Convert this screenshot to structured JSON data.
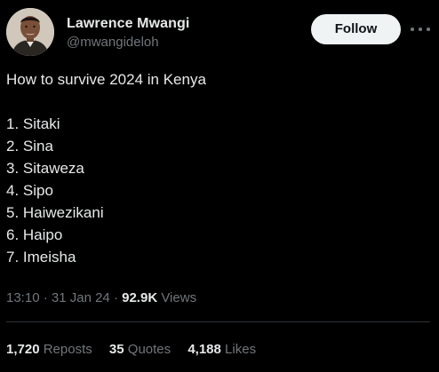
{
  "author": {
    "display_name": "Lawrence Mwangi",
    "handle": "@mwangideloh"
  },
  "actions": {
    "follow_label": "Follow",
    "more_icon": "more-horizontal-icon"
  },
  "tweet": {
    "lines": [
      "How to survive 2024 in Kenya",
      "",
      "1. Sitaki",
      "2. Sina",
      "3. Sitaweza",
      "4. Sipo",
      "5. Haiwezikani",
      "6. Haipo",
      "7. Imeisha"
    ]
  },
  "meta": {
    "time": "13:10",
    "separator": " · ",
    "date": "31 Jan 24",
    "views_count": "92.9K",
    "views_label": " Views"
  },
  "stats": {
    "reposts": {
      "count": "1,720",
      "label": "Reposts"
    },
    "quotes": {
      "count": "35",
      "label": "Quotes"
    },
    "likes": {
      "count": "4,188",
      "label": "Likes"
    }
  },
  "colors": {
    "background": "#000000",
    "text": "#e7e9ea",
    "secondary": "#71767b",
    "button_bg": "#eff3f4",
    "divider": "#2f3336"
  }
}
